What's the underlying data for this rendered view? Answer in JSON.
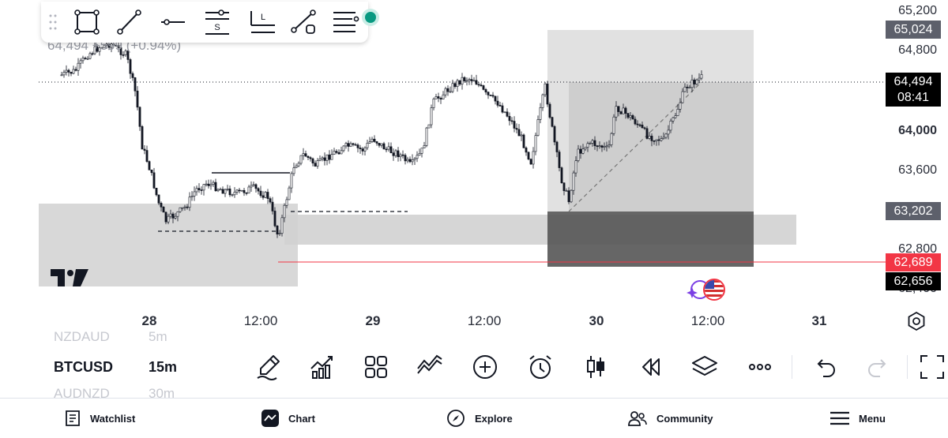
{
  "chart": {
    "legend": "64,494 +599 (+0.94%)",
    "price_axis": [
      "65,200",
      "64,800",
      "64,000",
      "63,600",
      "62,800",
      "62,400"
    ],
    "price_tags": {
      "upper_box": "65,024",
      "current_price": "64,494",
      "countdown": "08:41",
      "mid_box": "63,202",
      "red_line": "62,689",
      "low": "62,656"
    },
    "time_axis": [
      {
        "label": "28",
        "bold": true
      },
      {
        "label": "12:00",
        "bold": false
      },
      {
        "label": "29",
        "bold": true
      },
      {
        "label": "12:00",
        "bold": false
      },
      {
        "label": "30",
        "bold": true
      },
      {
        "label": "12:00",
        "bold": false
      },
      {
        "label": "31",
        "bold": true
      }
    ],
    "colors": {
      "accent_red": "#f23645",
      "status_green": "#089981",
      "box_gray": "#d1d1d1"
    }
  },
  "drawing_toolbar": {
    "tools": [
      "drag-handle-icon",
      "rectangle-tool-icon",
      "trendline-tool-icon",
      "horizontal-line-tool-icon",
      "short-position-tool-icon",
      "long-position-tool-icon",
      "path-tool-icon",
      "object-tree-icon"
    ]
  },
  "symbols": {
    "previous": {
      "name": "NZDAUD",
      "interval": "5m"
    },
    "current": {
      "name": "BTCUSD",
      "interval": "15m"
    },
    "next": {
      "name": "AUDNZD",
      "interval": "30m"
    }
  },
  "bottom_toolbar": {
    "tools": [
      "drawing-pen-icon",
      "indicators-icon",
      "layouts-grid-icon",
      "patterns-icon",
      "add-icon",
      "alert-clock-icon",
      "chart-type-candles-icon",
      "replay-icon",
      "layers-icon",
      "more-icon",
      "undo-icon",
      "redo-icon",
      "fullscreen-icon"
    ]
  },
  "nav": {
    "watchlist": "Watchlist",
    "chart": "Chart",
    "explore": "Explore",
    "community": "Community",
    "menu": "Menu"
  }
}
